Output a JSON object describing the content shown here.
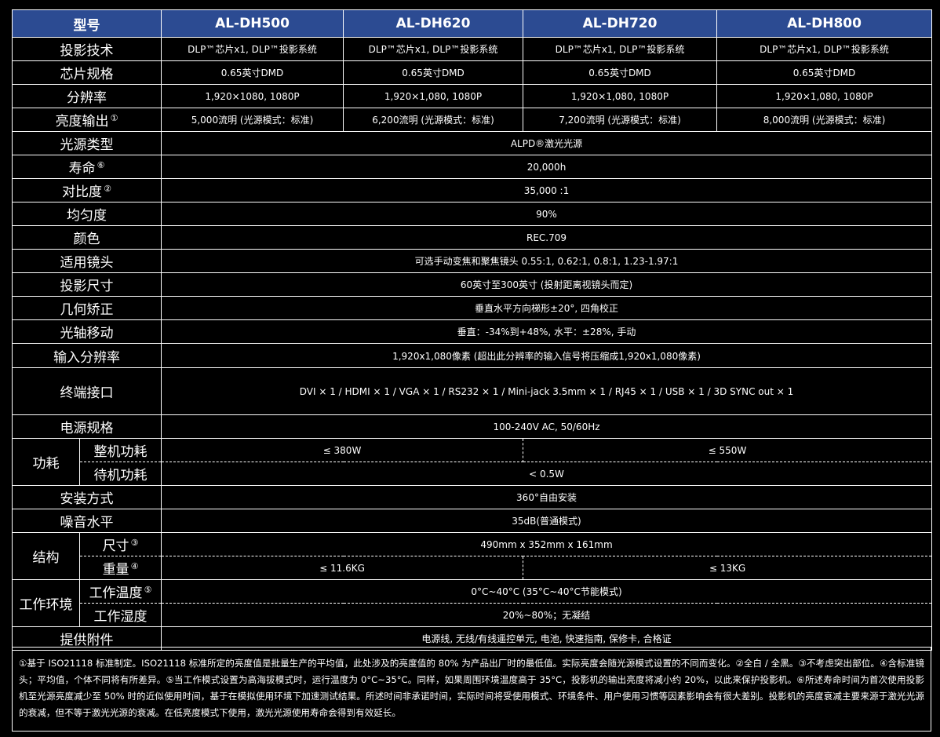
{
  "header": {
    "col_label": "型号",
    "models": [
      "AL-DH500",
      "AL-DH620",
      "AL-DH720",
      "AL-DH800"
    ]
  },
  "rows": {
    "projection_tech": {
      "label": "投影技术",
      "values": [
        "DLP™芯片x1, DLP™投影系统",
        "DLP™芯片x1, DLP™投影系统",
        "DLP™芯片x1, DLP™投影系统",
        "DLP™芯片x1, DLP™投影系统"
      ]
    },
    "chip_spec": {
      "label": "芯片规格",
      "values": [
        "0.65英寸DMD",
        "0.65英寸DMD",
        "0.65英寸DMD",
        "0.65英寸DMD"
      ]
    },
    "resolution": {
      "label": "分辨率",
      "values": [
        "1,920×1080, 1080P",
        "1,920×1,080, 1080P",
        "1,920×1,080, 1080P",
        "1,920×1,080, 1080P"
      ]
    },
    "brightness": {
      "label": "亮度输出",
      "note": "①",
      "values": [
        "5,000流明 (光源模式：标准)",
        "6,200流明 (光源模式：标准)",
        "7,200流明 (光源模式：标准)",
        "8,000流明 (光源模式：标准)"
      ]
    },
    "light_source": {
      "label": "光源类型",
      "value": "ALPD®激光光源"
    },
    "lifespan": {
      "label": "寿命",
      "note": "⑥",
      "value": "20,000h"
    },
    "contrast": {
      "label": "对比度",
      "note": "②",
      "value": "35,000 :1"
    },
    "uniformity": {
      "label": "均匀度",
      "value": "90%"
    },
    "color": {
      "label": "颜色",
      "value": "REC.709"
    },
    "lens": {
      "label": "适用镜头",
      "value": "可选手动变焦和聚焦镜头 0.55:1, 0.62:1, 0.8:1, 1.23-1.97:1"
    },
    "projection_size": {
      "label": "投影尺寸",
      "value": "60英寸至300英寸 (投射距离视镜头而定)"
    },
    "geometry": {
      "label": "几何矫正",
      "value": "垂直水平方向梯形±20°, 四角校正"
    },
    "lens_shift": {
      "label": "光轴移动",
      "value": "垂直：-34%到+48%, 水平：±28%, 手动"
    },
    "input_resolution": {
      "label": "输入分辨率",
      "value": "1,920x1,080像素 (超出此分辨率的输入信号将压缩成1,920x1,080像素)"
    },
    "terminals": {
      "label": "终端接口",
      "value": "DVI × 1 / HDMI × 1 / VGA × 1 / RS232 × 1 / Mini-jack 3.5mm × 1 / RJ45 × 1 / USB × 1 / 3D SYNC out × 1"
    },
    "power_spec": {
      "label": "电源规格",
      "value": "100-240V AC, 50/60Hz"
    },
    "power_consumption": {
      "label": "功耗",
      "full_label": "整机功耗",
      "full_values": [
        "≤ 380W",
        "≤ 550W"
      ],
      "standby_label": "待机功耗",
      "standby_value": "< 0.5W"
    },
    "installation": {
      "label": "安装方式",
      "value": "360°自由安装"
    },
    "noise": {
      "label": "噪音水平",
      "value": "35dB(普通模式)"
    },
    "structure": {
      "label": "结构",
      "size_label": "尺寸",
      "size_note": "③",
      "size_value": "490mm x 352mm x 161mm",
      "weight_label": "重量",
      "weight_note": "④",
      "weight_values": [
        "≤ 11.6KG",
        "≤ 13KG"
      ]
    },
    "environment": {
      "label": "工作环境",
      "temp_label": "工作温度",
      "temp_note": "⑤",
      "temp_value": "0°C~40°C (35°C~40°C节能模式)",
      "humidity_label": "工作湿度",
      "humidity_value": "20%~80%；无凝结"
    },
    "accessories": {
      "label": "提供附件",
      "value": "电源线, 无线/有线遥控单元, 电池, 快速指南, 保修卡, 合格证"
    }
  },
  "footnotes": "①基于 ISO21118 标准制定。ISO21118 标准所定的亮度值是批量生产的平均值，此处涉及的亮度值的 80% 为产品出厂时的最低值。实际亮度会随光源模式设置的不同而变化。②全白 / 全黑。③不考虑突出部位。④含标准镜头；平均值，个体不同将有所差异。⑤当工作模式设置为高海拔模式时，运行温度为 0°C~35°C。同样，如果周围环境温度高于 35°C，投影机的输出亮度将减小约 20%，以此来保护投影机。⑥所述寿命时间为首次使用投影机至光源亮度减少至 50% 时的近似使用时间，基于在模拟使用环境下加速测试结果。所述时间非承诺时间，实际时间将受使用模式、环境条件、用户使用习惯等因素影响会有很大差别。投影机的亮度衰减主要来源于激光光源的衰减，但不等于激光光源的衰减。在低亮度模式下使用，激光光源使用寿命会得到有效延长。"
}
